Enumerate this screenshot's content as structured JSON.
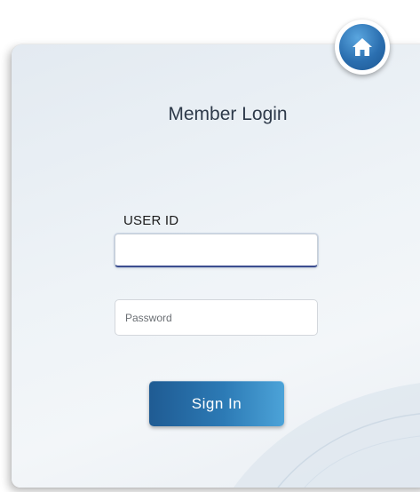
{
  "login": {
    "title": "Member Login",
    "user_id_label": "USER ID",
    "user_id_value": "",
    "password_placeholder": "Password",
    "password_value": "",
    "sign_in_label": "Sign In"
  },
  "icons": {
    "home": "home-icon"
  },
  "colors": {
    "accent": "#2b6fb0",
    "button_start": "#1f5b93",
    "button_end": "#4ca3d8",
    "title_text": "#2e3a4a"
  }
}
